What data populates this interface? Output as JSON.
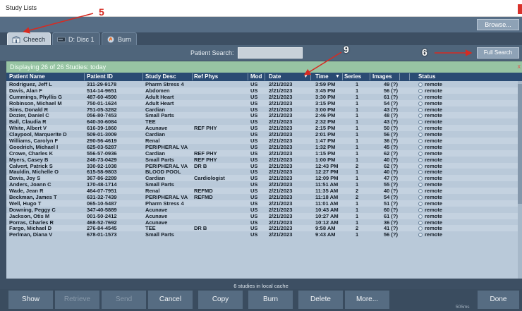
{
  "window": {
    "title": "Study Lists"
  },
  "toolbar": {
    "browse_label": "Browse..."
  },
  "tabs": [
    {
      "label": "Cheech",
      "icon": "hospital-icon",
      "active": true
    },
    {
      "label": "D: Disc 1",
      "icon": "disc-drive-icon",
      "active": false
    },
    {
      "label": "Burn",
      "icon": "burn-disc-icon",
      "active": false
    }
  ],
  "search": {
    "label": "Patient Search:",
    "value": "",
    "full_search_label": "Full Search"
  },
  "status": {
    "text": "Displaying 26 of 26 Studies: today",
    "close": "x"
  },
  "columns": [
    "Patient Name",
    "Patient ID",
    "Study Desc",
    "Ref Phys",
    "Mod",
    "Date",
    "Time",
    "Series",
    "Images",
    "Status"
  ],
  "sort_arrows": {
    "date": "▼",
    "time": "▼"
  },
  "rows": [
    [
      "Rodriguez, Jeff L",
      "311-29-9178",
      "Pharm Stress 4",
      "",
      "US",
      "2/21/2023",
      "3:59 PM",
      "1",
      "49 (?)",
      "remote"
    ],
    [
      "Davis, Alan F",
      "514-14-9651",
      "Abdomen",
      "",
      "US",
      "2/21/2023",
      "3:45 PM",
      "1",
      "56 (?)",
      "remote"
    ],
    [
      "Cummings, Phyllis G",
      "487-60-4590",
      "Adult Heart",
      "",
      "US",
      "2/21/2023",
      "3:30 PM",
      "1",
      "61 (?)",
      "remote"
    ],
    [
      "Robinson, Michael M",
      "750-01-1624",
      "Adult Heart",
      "",
      "US",
      "2/21/2023",
      "3:15 PM",
      "1",
      "54 (?)",
      "remote"
    ],
    [
      "Sims, Donald R",
      "751-05-3282",
      "Cardian",
      "",
      "US",
      "2/21/2023",
      "3:00 PM",
      "1",
      "43 (?)",
      "remote"
    ],
    [
      "Dozier, Daniel C",
      "056-80-7453",
      "Small Parts",
      "",
      "US",
      "2/21/2023",
      "2:46 PM",
      "1",
      "48 (?)",
      "remote"
    ],
    [
      "Ball, Claudia R",
      "640-30-6084",
      "TEE",
      "",
      "US",
      "2/21/2023",
      "2:32 PM",
      "1",
      "43 (?)",
      "remote"
    ],
    [
      "White, Albert V",
      "616-39-1860",
      "Acunave",
      "REF PHY",
      "US",
      "2/21/2023",
      "2:15 PM",
      "1",
      "50 (?)",
      "remote"
    ],
    [
      "Claypool, Marquerite D",
      "509-01-3009",
      "Cardian",
      "",
      "US",
      "2/21/2023",
      "2:01 PM",
      "1",
      "56 (?)",
      "remote"
    ],
    [
      "Williams, Carolyn F",
      "290-56-4619",
      "Renal",
      "",
      "US",
      "2/21/2023",
      "1:47 PM",
      "1",
      "36 (?)",
      "remote"
    ],
    [
      "Goodrich, Michael I",
      "625-03-5287",
      "PERIPHERAL VA",
      "",
      "US",
      "2/21/2023",
      "1:32 PM",
      "1",
      "45 (?)",
      "remote"
    ],
    [
      "Crowe, Charles K",
      "556-57-0936",
      "Cardian",
      "REF PHY",
      "US",
      "2/21/2023",
      "1:15 PM",
      "1",
      "62 (?)",
      "remote"
    ],
    [
      "Myers, Casey B",
      "246-73-0429",
      "Small Parts",
      "REF PHY",
      "US",
      "2/21/2023",
      "1:00 PM",
      "1",
      "40 (?)",
      "remote"
    ],
    [
      "Calvert, Patrick S",
      "330-92-1038",
      "PERIPHERAL VA",
      "DR B",
      "US",
      "2/21/2023",
      "12:43 PM",
      "2",
      "62 (?)",
      "remote"
    ],
    [
      "Mauldin, Michelle O",
      "615-58-9803",
      "BLOOD POOL",
      "",
      "US",
      "2/21/2023",
      "12:27 PM",
      "1",
      "40 (?)",
      "remote"
    ],
    [
      "Davis, Joy S",
      "367-86-2289",
      "Cardian",
      "Cardiologist",
      "US",
      "2/21/2023",
      "12:09 PM",
      "1",
      "47 (?)",
      "remote"
    ],
    [
      "Anders, Joann C",
      "170-48-1714",
      "Small Parts",
      "",
      "US",
      "2/21/2023",
      "11:51 AM",
      "1",
      "55 (?)",
      "remote"
    ],
    [
      "Wade, Jean R",
      "464-07-7951",
      "Renal",
      "REFMD",
      "US",
      "2/21/2023",
      "11:35 AM",
      "2",
      "40 (?)",
      "remote"
    ],
    [
      "Beckman, James T",
      "631-32-7439",
      "PERIPHERAL VA",
      "REFMD",
      "US",
      "2/21/2023",
      "11:18 AM",
      "2",
      "54 (?)",
      "remote"
    ],
    [
      "Well, Hugo T",
      "065-10-5487",
      "Pharm Stress 4",
      "",
      "US",
      "2/21/2023",
      "11:01 AM",
      "1",
      "51 (?)",
      "remote"
    ],
    [
      "Downing, Peggy C",
      "347-40-5889",
      "Acunave",
      "",
      "US",
      "2/21/2023",
      "10:43 AM",
      "1",
      "60 (?)",
      "remote"
    ],
    [
      "Jackson, Otis M",
      "001-50-2412",
      "Acunave",
      "",
      "US",
      "2/21/2023",
      "10:27 AM",
      "1",
      "61 (?)",
      "remote"
    ],
    [
      "Porras, Charles R",
      "468-52-7692",
      "Acunave",
      "",
      "US",
      "2/21/2023",
      "10:12 AM",
      "1",
      "36 (?)",
      "remote"
    ],
    [
      "Fargo, Michael D",
      "276-84-4545",
      "TEE",
      "DR B",
      "US",
      "2/21/2023",
      "9:58 AM",
      "2",
      "41 (?)",
      "remote"
    ],
    [
      "Perlman, Diana V",
      "678-01-1573",
      "Small Parts",
      "",
      "US",
      "2/21/2023",
      "9:43 AM",
      "1",
      "56 (?)",
      "remote"
    ]
  ],
  "cache_text": "6 studies in local cache",
  "buttons": [
    {
      "label": "Show",
      "enabled": true
    },
    {
      "label": "Retrieve",
      "enabled": false
    },
    {
      "label": "Send",
      "enabled": false
    },
    {
      "label": "Cancel",
      "enabled": true
    },
    {
      "label": "Copy",
      "enabled": true
    },
    {
      "label": "Burn",
      "enabled": true
    },
    {
      "label": "Delete",
      "enabled": true
    },
    {
      "label": "More...",
      "enabled": true
    },
    {
      "label": "Done",
      "enabled": true
    }
  ],
  "timing": "505ms",
  "annotations": [
    {
      "label": "5",
      "color": "#d62b22"
    },
    {
      "label": "6",
      "color": "#ffffff"
    },
    {
      "label": "9",
      "color": "#ffffff"
    }
  ]
}
